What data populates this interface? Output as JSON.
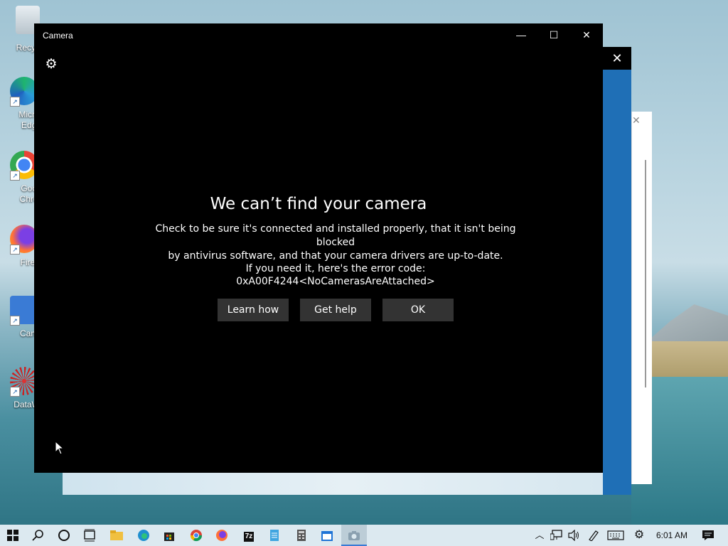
{
  "desktop": {
    "icons": [
      {
        "label": "Recycle",
        "icon": "recycle-bin-icon"
      },
      {
        "label": "Micros\nEdge",
        "icon": "edge-icon"
      },
      {
        "label": "Goog\nChron",
        "icon": "chrome-icon"
      },
      {
        "label": "Firefo",
        "icon": "firefox-icon"
      },
      {
        "label": "Came",
        "icon": "camera-icon"
      },
      {
        "label": "DataWag",
        "icon": "datawag-icon"
      }
    ]
  },
  "background_window": {
    "close_glyph": "✕"
  },
  "camera_window": {
    "title": "Camera",
    "minimize_glyph": "—",
    "maximize_glyph": "☐",
    "close_glyph": "✕",
    "settings_glyph": "⚙",
    "error": {
      "heading": "We can’t find your camera",
      "message_line1": "Check to be sure it's connected and installed properly, that it isn't being blocked",
      "message_line2": "by antivirus software, and that your camera drivers are up-to-date.",
      "code_intro": "If you need it, here's the error code:",
      "code": "0xA00F4244<NoCamerasAreAttached>"
    },
    "buttons": {
      "learn_how": "Learn how",
      "get_help": "Get help",
      "ok": "OK"
    }
  },
  "taskbar": {
    "clock": "6:01 AM",
    "apps": [
      "start-icon",
      "search-icon",
      "cortana-icon",
      "task-view-icon",
      "file-explorer-icon",
      "edge-icon",
      "store-icon",
      "chrome-icon",
      "firefox-icon",
      "7zip-icon",
      "notepad-icon",
      "calculator-icon",
      "calendar-icon",
      "camera-icon"
    ],
    "seven_zip_label": "7z"
  },
  "colors": {
    "accent": "#3a7bd5",
    "window_bg": "#000000",
    "button_bg": "#333333"
  }
}
